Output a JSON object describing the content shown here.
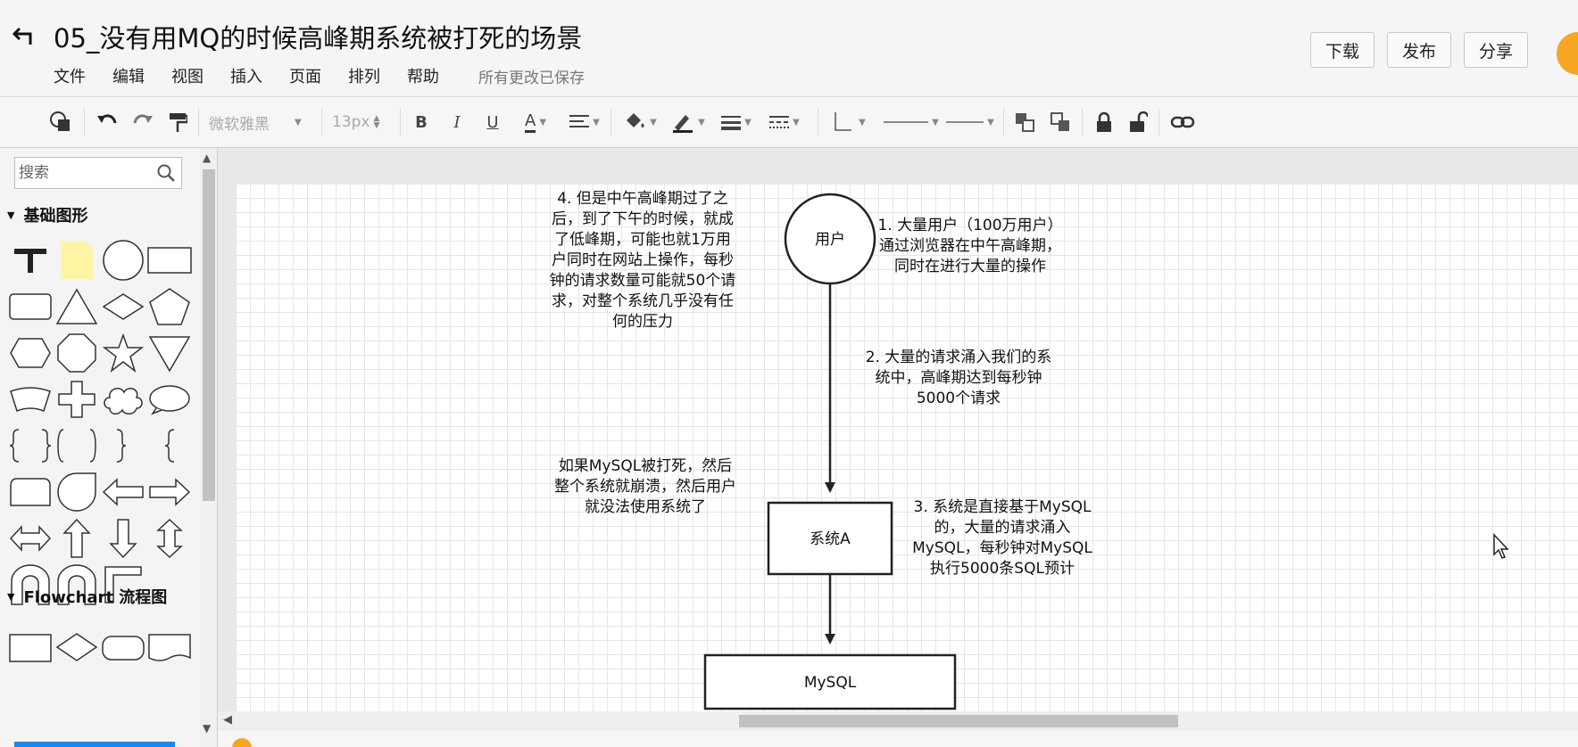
{
  "header": {
    "title": "05_没有用MQ的时候高峰期系统被打死的场景",
    "menu": [
      "文件",
      "编辑",
      "视图",
      "插入",
      "页面",
      "排列",
      "帮助"
    ],
    "save_status": "所有更改已保存",
    "buttons": {
      "download": "下载",
      "publish": "发布",
      "share": "分享"
    }
  },
  "toolbar": {
    "font_family": "微软雅黑",
    "font_size": "13px",
    "bold": "B",
    "italic": "I",
    "underline": "U",
    "font_color": "A"
  },
  "sidebar": {
    "search": {
      "placeholder": "搜索",
      "value": ""
    },
    "sections": {
      "basic": "基础图形",
      "flowchart": "Flowchart 流程图"
    }
  },
  "diagram": {
    "nodes": {
      "user": "用户",
      "system_a": "系统A",
      "mysql": "MySQL"
    },
    "notes": {
      "note1": "1. 大量用户（100万用户）\n通过浏览器在中午高峰期，\n同时在进行大量的操作",
      "note2": "2. 大量的请求涌入我们的系\n统中，高峰期达到每秒钟\n5000个请求",
      "note3": "3. 系统是直接基于MySQL\n的，大量的请求涌入\nMySQL，每秒钟对MySQL\n执行5000条SQL预计",
      "note4": "4. 但是中午高峰期过了之\n后，到了下午的时候，就成\n了低峰期，可能也就1万用\n户同时在网站上操作，每秒\n钟的请求数量可能就50个请\n求，对整个系统几乎没有任\n何的压力",
      "note5": "如果MySQL被打死，然后\n整个系统就崩溃，然后用户\n就没法使用系统了"
    }
  },
  "colors": {
    "accent": "#f5a623",
    "scroll_bar": "#1e88e5",
    "note_fill": "#fff4a3"
  }
}
